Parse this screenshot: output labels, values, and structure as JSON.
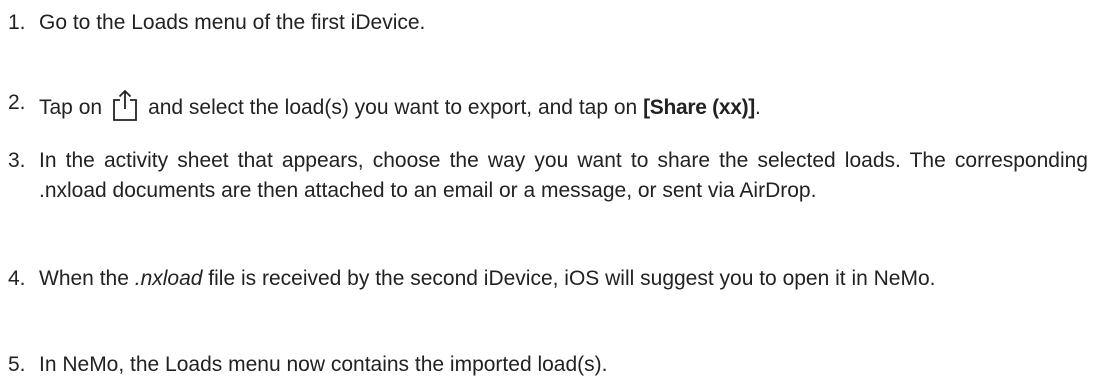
{
  "steps": [
    {
      "number": "1.",
      "text": "Go to the Loads menu of the first iDevice."
    },
    {
      "number": "2.",
      "text_before_icon": "Tap on",
      "icon": "share-icon",
      "text_after_icon": "and select the load(s) you want to export, and tap on",
      "button_label": "[Share (xx)]",
      "text_end": "."
    },
    {
      "number": "3.",
      "text": "In the activity sheet that appears, choose the way you want to share the selected loads. The corresponding .nxload documents are then attached to an email or a message, or sent via AirDrop."
    },
    {
      "number": "4.",
      "text_before": "When the",
      "file_type": ".nxload",
      "text_after": "file is received by the second iDevice, iOS will suggest you to open it in NeMo."
    },
    {
      "number": "5.",
      "text": "In NeMo, the Loads menu now contains the imported load(s)."
    }
  ],
  "colors": {
    "text": "#222222",
    "background": "#ffffff"
  }
}
